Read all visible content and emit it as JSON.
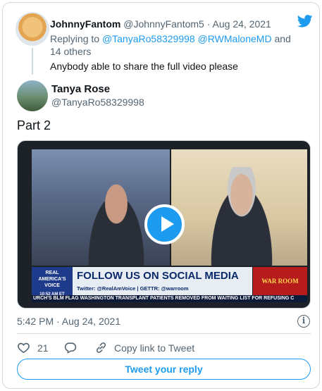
{
  "reply": {
    "name": "JohnnyFantom",
    "handle": "@JohnnyFantom5",
    "separator": "·",
    "date": "Aug 24, 2021",
    "replying_prefix": "Replying to",
    "replying_to_1": "@TanyaRo58329998",
    "replying_to_2": "@RWMaloneMD",
    "replying_suffix": "and 14 others",
    "text": "Anybody able to share the full video please"
  },
  "tweet": {
    "name": "Tanya Rose",
    "handle": "@TanyaRo58329998",
    "text": "Part 2",
    "timestamp": "5:42 PM · Aug 24, 2021",
    "likes": "21",
    "copy_link_label": "Copy link to Tweet",
    "reply_button_label": "Tweet your reply"
  },
  "video": {
    "logo_text": "REAL AMERICA'S VOICE",
    "clock": "10:52 AM ET",
    "lower_third_title": "FOLLOW US ON SOCIAL MEDIA",
    "lower_third_sub": "Twitter: @RealAmVoice | GETTR: @warroom",
    "show_logo": "WAR ROOM",
    "ticker": "URCH'S BLM FLAG    WASHINGTON TRANSPLANT PATIENTS REMOVED FROM WAITING LIST FOR REFUSING C"
  },
  "icons": {
    "brand": "twitter-bird-icon",
    "play": "play-icon",
    "info": "info-icon",
    "like": "heart-icon",
    "reply": "reply-icon",
    "copy_link": "link-icon"
  },
  "colors": {
    "accent": "#1d9bf0",
    "text": "#0f1419",
    "muted": "#536471",
    "border": "#cfd9de"
  }
}
